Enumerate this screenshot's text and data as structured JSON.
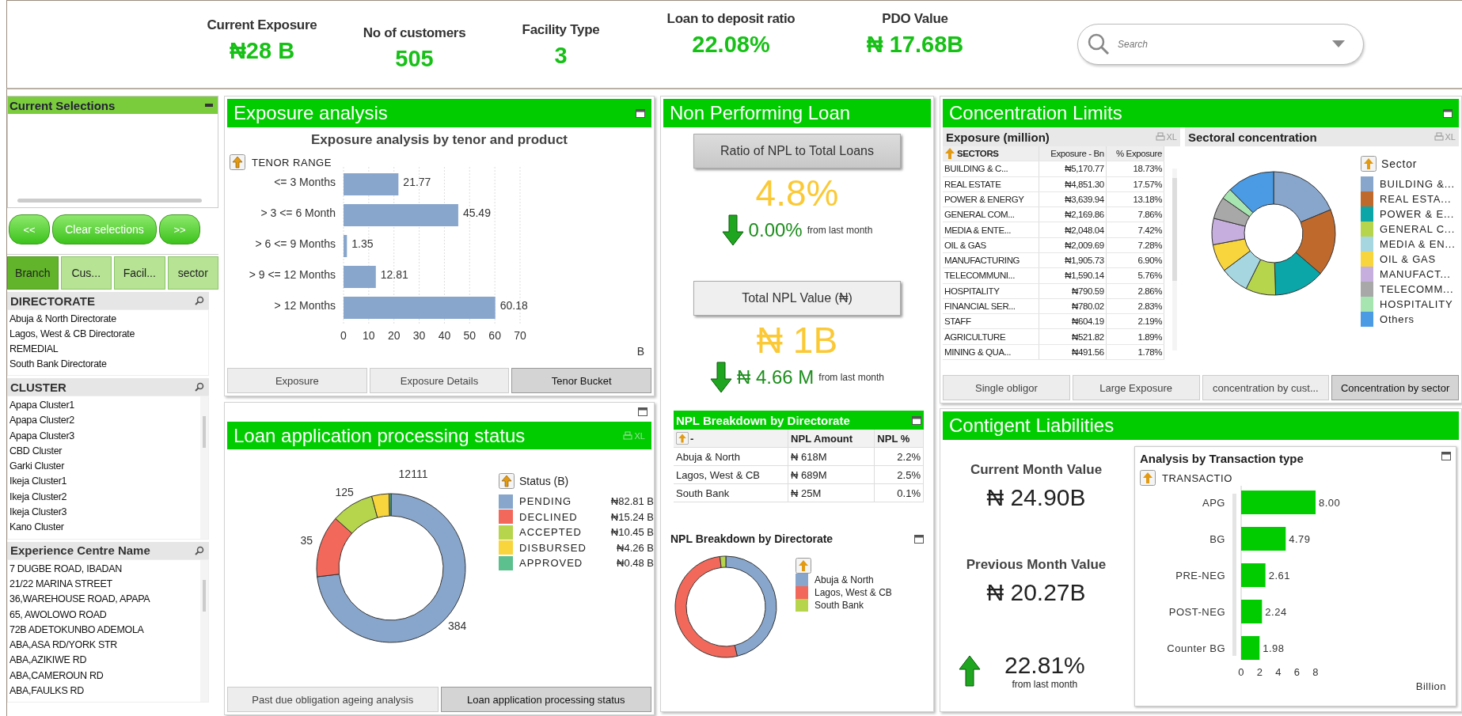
{
  "header": {
    "kpis": [
      {
        "label": "Current Exposure",
        "value": "₦28 B"
      },
      {
        "label": "No of customers",
        "value": "505"
      },
      {
        "label": "Facility Type",
        "value": "3"
      },
      {
        "label": "Loan to deposit ratio",
        "value": "22.08%"
      },
      {
        "label": "PDO Value",
        "value": "₦ 17.68B"
      }
    ],
    "search": {
      "placeholder": "Search"
    }
  },
  "sidebar": {
    "current_selections": {
      "title": "Current Selections"
    },
    "buttons": [
      "<<",
      "Clear selections",
      ">>"
    ],
    "tabs": [
      {
        "label": "Branch",
        "selected": true
      },
      {
        "label": "Cus...",
        "selected": false
      },
      {
        "label": "Facil...",
        "selected": false
      },
      {
        "label": "sector",
        "selected": false
      }
    ],
    "lists": [
      {
        "title": "DIRECTORATE",
        "scrollable": false,
        "items": [
          "Abuja & North Directorate",
          "Lagos, West & CB Directorate",
          "REMEDIAL",
          "South Bank Directorate"
        ]
      },
      {
        "title": "CLUSTER",
        "scrollable": true,
        "items": [
          "Apapa Cluster1",
          "Apapa Cluster2",
          "Apapa Cluster3",
          "CBD Cluster",
          "Garki Cluster",
          "Ikeja Cluster1",
          "Ikeja Cluster2",
          "Ikeja Cluster3",
          "Kano Cluster"
        ]
      },
      {
        "title": "Experience Centre Name",
        "scrollable": true,
        "items": [
          "7 DUGBE ROAD, IBADAN",
          "21/22 MARINA STREET",
          "36,WAREHOUSE ROAD, APAPA",
          "65, AWOLOWO ROAD",
          "72B ADETOKUNBO ADEMOLA",
          "ABA,ASA RD/YORK STR",
          "ABA,AZIKIWE RD",
          "ABA,CAMEROUN RD",
          "ABA,FAULKS RD"
        ]
      }
    ]
  },
  "exposure_analysis": {
    "title": "Exposure analysis",
    "subtitle": "Exposure analysis by tenor and product",
    "dimension": "TENOR RANGE",
    "unit": "B",
    "chart_data": {
      "type": "bar",
      "orientation": "horizontal",
      "categories": [
        "<= 3 Months",
        "> 3 <= 6 Month",
        "> 6 <= 9 Months",
        "> 9 <= 12 Months",
        "> 12 Months"
      ],
      "values": [
        21.77,
        45.49,
        1.35,
        12.81,
        60.18
      ],
      "xlim": [
        0,
        70
      ],
      "xticks": [
        0,
        10,
        20,
        30,
        40,
        50,
        60,
        70
      ],
      "grid": true,
      "data_labels": true
    },
    "tabs": [
      {
        "label": "Exposure",
        "selected": false
      },
      {
        "label": "Exposure Details",
        "selected": false
      },
      {
        "label": "Tenor Bucket",
        "selected": true
      }
    ]
  },
  "loan_status": {
    "title": "Loan application processing status",
    "export": "XL",
    "legend_title": "Status (B)",
    "chart_data": {
      "type": "donut",
      "categories": [
        "PENDING",
        "DECLINED",
        "ACCEPTED",
        "DISBURSED",
        "APPROVED"
      ],
      "values": [
        73.13,
        13.46,
        9.23,
        3.76,
        0.42
      ]
    },
    "count_labels": [
      "384",
      "35",
      "125",
      "12111"
    ],
    "legend": [
      {
        "amount": "₦82.81 B",
        "color": "#88a6cc"
      },
      {
        "amount": "₦15.24 B",
        "color": "#f2685a"
      },
      {
        "amount": "₦10.45 B",
        "color": "#b6d44c"
      },
      {
        "amount": "₦4.26 B",
        "color": "#f8d53c"
      },
      {
        "amount": "₦0.48 B",
        "color": "#5cbf8e"
      }
    ],
    "tabs": [
      {
        "label": "Past due obligation ageing analysis",
        "selected": false
      },
      {
        "label": "Loan application processing status",
        "selected": true
      }
    ]
  },
  "npl": {
    "title": "Non Performing Loan",
    "ratio": {
      "button": "Ratio of NPL to Total Loans",
      "value": "4.8%",
      "up": false,
      "change": "0.00%",
      "note": "from last month"
    },
    "total": {
      "button": "Total NPL Value (₦)",
      "value": "₦ 1B",
      "up": false,
      "change": "₦ 4.66 M",
      "note": "from last month"
    },
    "table": {
      "title": "NPL Breakdown by Directorate",
      "columns": [
        "-",
        "NPL Amount",
        "NPL %"
      ],
      "rows": [
        [
          "Abuja & North",
          "₦ 618M",
          "2.2%"
        ],
        [
          "Lagos, West & CB",
          "₦ 689M",
          "2.5%"
        ],
        [
          "South Bank",
          "₦ 25M",
          "0.1%"
        ]
      ]
    },
    "donut": {
      "title": "NPL Breakdown by Directorate",
      "chart_data": {
        "type": "donut",
        "categories": [
          "Abuja & North",
          "Lagos, West & CB",
          "South Bank"
        ],
        "values": [
          46.4,
          51.73,
          1.87
        ]
      },
      "legend": [
        {
          "color": "#88a6cc"
        },
        {
          "color": "#f2685a"
        },
        {
          "color": "#b6d44c"
        }
      ]
    }
  },
  "concentration": {
    "title": "Concentration Limits",
    "table": {
      "title": "Exposure (million)",
      "export": "XL",
      "columns": [
        "SECTORS",
        "Exposure - Bn",
        "% Exposure"
      ],
      "rows": [
        [
          "BUILDING & C...",
          "₦5,170.77",
          "18.73%"
        ],
        [
          "REAL ESTATE",
          "₦4,851.30",
          "17.57%"
        ],
        [
          "POWER & ENERGY",
          "₦3,639.94",
          "13.18%"
        ],
        [
          "GENERAL COM...",
          "₦2,169.86",
          "7.86%"
        ],
        [
          "MEDIA & ENTE...",
          "₦2,048.04",
          "7.42%"
        ],
        [
          "OIL & GAS",
          "₦2,009.69",
          "7.28%"
        ],
        [
          "MANUFACTURING",
          "₦1,905.73",
          "6.90%"
        ],
        [
          "TELECOMMUNI...",
          "₦1,590.14",
          "5.76%"
        ],
        [
          "HOSPITALITY",
          "₦790.59",
          "2.86%"
        ],
        [
          "FINANCIAL SER...",
          "₦780.02",
          "2.83%"
        ],
        [
          "STAFF",
          "₦604.19",
          "2.19%"
        ],
        [
          "AGRICULTURE",
          "₦521.82",
          "1.89%"
        ],
        [
          "MINING & QUA...",
          "₦491.56",
          "1.78%"
        ]
      ]
    },
    "sectoral": {
      "title": "Sectoral concentration",
      "export": "XL",
      "legend_title": "Sector",
      "chart_data": {
        "type": "donut",
        "categories": [
          "BUILDING &...",
          "REAL ESTA...",
          "POWER & E...",
          "GENERAL C...",
          "MEDIA & EN...",
          "OIL & GAS",
          "MANUFACT...",
          "TELECOMM...",
          "HOSPITALITY",
          "Others"
        ],
        "values": [
          18.73,
          17.57,
          13.18,
          7.86,
          7.42,
          7.28,
          6.9,
          5.76,
          2.86,
          12.44
        ]
      },
      "legend": [
        {
          "color": "#88a6cc"
        },
        {
          "color": "#c0692c"
        },
        {
          "color": "#0aa6a8"
        },
        {
          "color": "#b6d44c"
        },
        {
          "color": "#a6d6e0"
        },
        {
          "color": "#f8d53c"
        },
        {
          "color": "#c6aede"
        },
        {
          "color": "#a8a8a8"
        },
        {
          "color": "#a6e4b0"
        },
        {
          "color": "#4a9be4"
        }
      ]
    },
    "tabs": [
      {
        "label": "Single obligor",
        "selected": false
      },
      {
        "label": "Large Exposure",
        "selected": false
      },
      {
        "label": "concentration by cust...",
        "selected": false
      },
      {
        "label": "Concentration by sector",
        "selected": true
      }
    ]
  },
  "contingent": {
    "title": "Contigent Liabilities",
    "current": {
      "label": "Current Month Value",
      "value": "₦ 24.90B"
    },
    "previous": {
      "label": "Previous Month Value",
      "value": "₦ 20.27B"
    },
    "change": {
      "up": true,
      "value": "22.81%",
      "note": "from last month"
    },
    "chart": {
      "title": "Analysis by Transaction type",
      "dimension": "TRANSACTIO",
      "unit": "Billion",
      "chart_data": {
        "type": "bar",
        "orientation": "horizontal",
        "categories": [
          "APG",
          "BG",
          "PRE-NEG",
          "POST-NEG",
          "Counter BG"
        ],
        "values": [
          8.0,
          4.79,
          2.61,
          2.24,
          1.98
        ],
        "xlim": [
          0,
          8
        ],
        "xticks": [
          0,
          2,
          4,
          6,
          8
        ],
        "value_labels": [
          "8.00",
          "4.79",
          "2.61",
          "2.24",
          "1.98"
        ]
      }
    }
  }
}
